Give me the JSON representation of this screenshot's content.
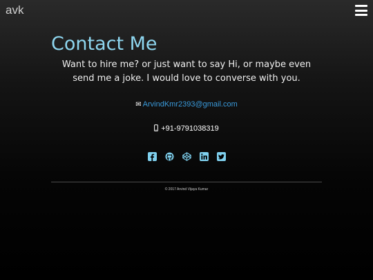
{
  "header": {
    "brand": "avk"
  },
  "contact": {
    "title": "Contact Me",
    "tagline": "Want to hire me? or just want to say Hi, or maybe even send me a joke. I would love to converse with you.",
    "email": "ArvindKmr2393@gmail.com",
    "phone": "+91-9791038319"
  },
  "socials": [
    {
      "icon": "facebook-icon"
    },
    {
      "icon": "github-icon"
    },
    {
      "icon": "codepen-icon"
    },
    {
      "icon": "linkedin-icon"
    },
    {
      "icon": "twitter-icon"
    }
  ],
  "footer": {
    "copyright": "© 2017 Arvind Vijaya Kumar"
  },
  "colors": {
    "accent": "#8ed6ef",
    "link": "#3a9bdc",
    "social": "#7fd0ee"
  }
}
